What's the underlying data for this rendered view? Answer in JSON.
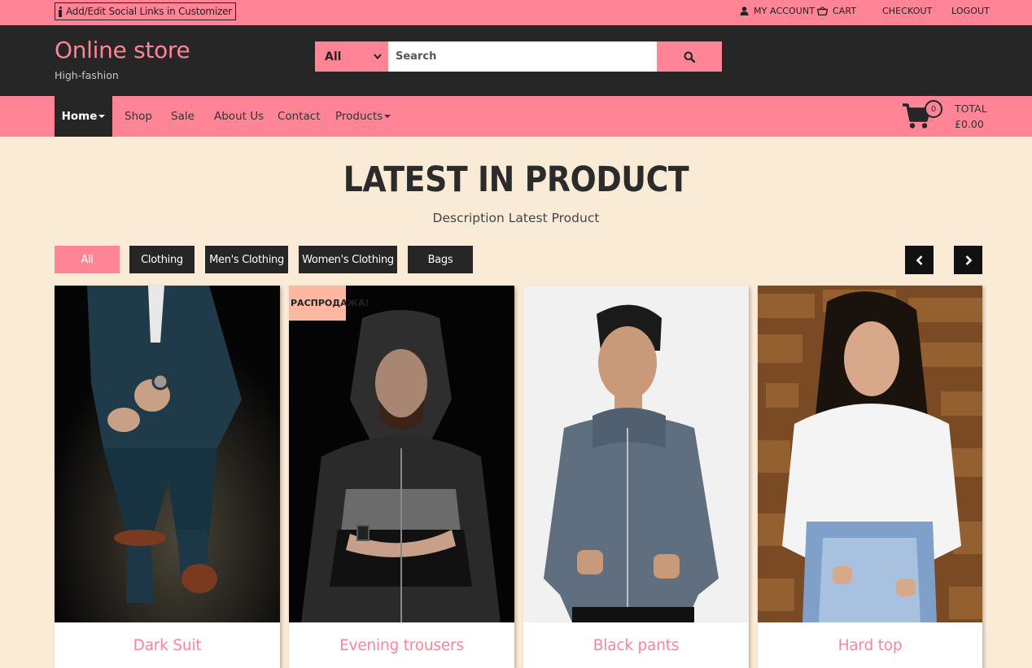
{
  "topbar": {
    "social_notice": "Add/Edit Social Links in Customizer",
    "links": [
      {
        "label": "MY ACCOUNT",
        "icon": "user-icon"
      },
      {
        "label": "CART",
        "icon": "basket-icon"
      },
      {
        "label": "CHECKOUT",
        "icon": ""
      },
      {
        "label": "LOGOUT",
        "icon": ""
      }
    ]
  },
  "header": {
    "site_title": "Online store",
    "tagline": "High-fashion",
    "search": {
      "category": "All",
      "placeholder": "Search"
    }
  },
  "nav": {
    "items": [
      {
        "label": "Home",
        "dropdown": true,
        "active": true
      },
      {
        "label": "Shop"
      },
      {
        "label": "Sale"
      },
      {
        "label": "About Us"
      },
      {
        "label": "Contact"
      },
      {
        "label": "Products",
        "dropdown": true
      }
    ],
    "cart": {
      "count": "0",
      "total_label": "TOTAL",
      "total_value": "£0.00"
    }
  },
  "section": {
    "title": "LATEST IN PRODUCT",
    "description": "Description Latest Product",
    "filters": [
      "All",
      "Clothing",
      "Men's Clothing",
      "Women's Clothing",
      "Bags"
    ]
  },
  "products": [
    {
      "name": "Dark Suit",
      "photo": "man in dark teal suit adjusting watch"
    },
    {
      "name": "Evening trousers",
      "photo": "bearded man in dark hoodie",
      "badge": "РАСПРОДАЖА!"
    },
    {
      "name": "Black pants",
      "photo": "young man in grey zip hoodie"
    },
    {
      "name": "Hard top",
      "photo": "woman in white blouse against brick wall"
    }
  ],
  "colors": {
    "accent": "#fe8496",
    "dark": "#262626",
    "background": "#faebd7",
    "badge": "#fcb8a0"
  }
}
